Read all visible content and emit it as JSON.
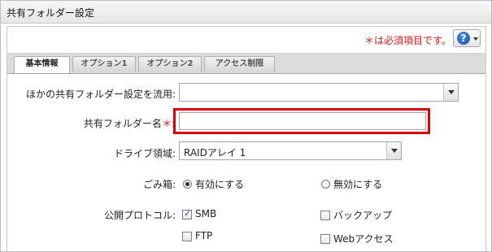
{
  "window": {
    "title": "共有フォルダー設定"
  },
  "header": {
    "required_note": "＊は必須項目です。",
    "help_symbol": "?"
  },
  "tabs": [
    {
      "label": "基本情報",
      "active": true
    },
    {
      "label": "オプション1",
      "active": false
    },
    {
      "label": "オプション2",
      "active": false
    },
    {
      "label": "アクセス制限",
      "active": false
    }
  ],
  "form": {
    "apply_settings": {
      "label": "ほかの共有フォルダー設定を流用:",
      "value": ""
    },
    "folder_name": {
      "label": "共有フォルダー名",
      "required_mark": "＊",
      "colon": ":",
      "value": ""
    },
    "drive_area": {
      "label": "ドライブ領域:",
      "value": "RAIDアレイ 1"
    },
    "recycle_bin": {
      "label": "ごみ箱:",
      "options": [
        {
          "label": "有効にする",
          "selected": true
        },
        {
          "label": "無効にする",
          "selected": false
        }
      ]
    },
    "protocols": {
      "label": "公開プロトコル:",
      "options": [
        {
          "label": "SMB",
          "checked": true
        },
        {
          "label": "バックアップ",
          "checked": false
        },
        {
          "label": "FTP",
          "checked": false
        },
        {
          "label": "Webアクセス",
          "checked": false
        }
      ]
    }
  },
  "colors": {
    "required": "#e01010",
    "highlight": "#dd0000",
    "help_blue": "#1a5fc0"
  }
}
